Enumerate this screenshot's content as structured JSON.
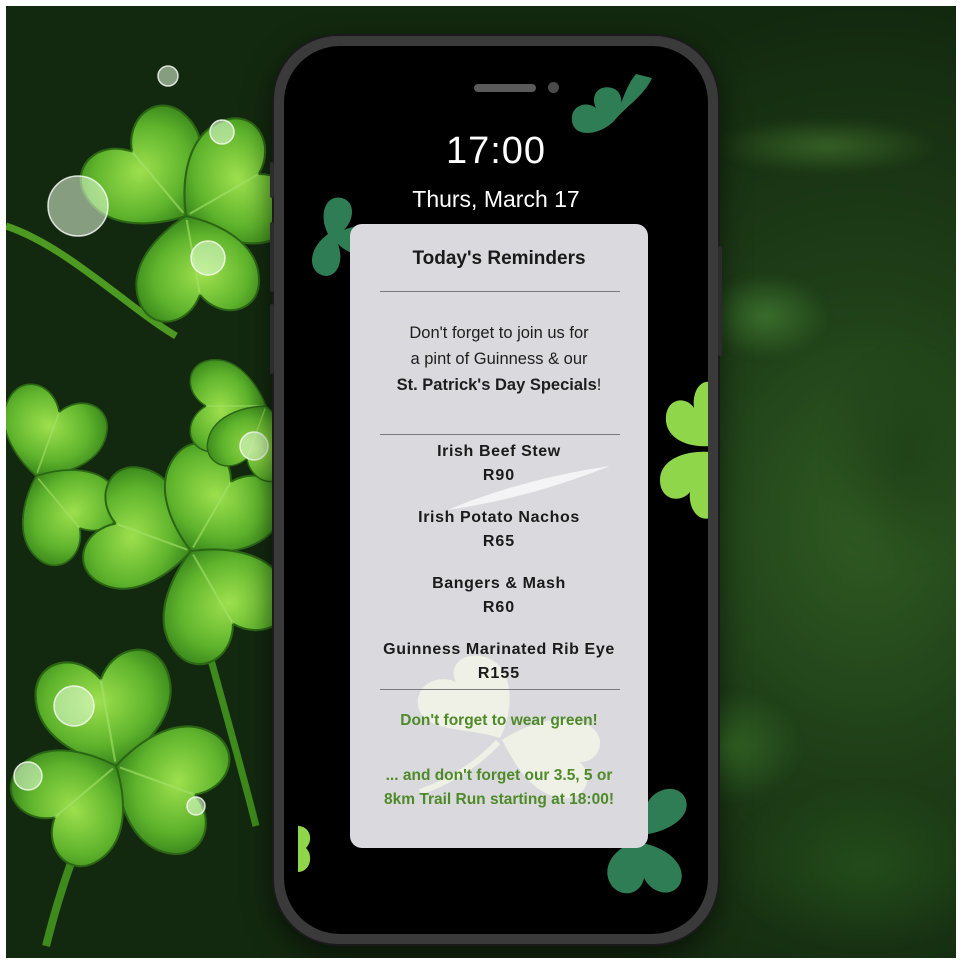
{
  "lockscreen": {
    "time": "17:00",
    "date": "Thurs, March 17"
  },
  "card": {
    "title": "Today's Reminders",
    "intro_line1": "Don't forget to join us for",
    "intro_line2": "a pint of Guinness & our",
    "intro_bold": "St. Patrick's Day Specials",
    "intro_end": "!",
    "menu": [
      {
        "name": "Irish Beef Stew",
        "price": "R90"
      },
      {
        "name": "Irish Potato Nachos",
        "price": "R65"
      },
      {
        "name": "Bangers & Mash",
        "price": "R60"
      },
      {
        "name": "Guinness Marinated Rib Eye",
        "price": "R155"
      }
    ],
    "green_note": "Don't forget to wear green!",
    "trail_note": "... and don't forget our 3.5, 5 or 8km Trail Run starting at 18:00!"
  },
  "colors": {
    "accent_green": "#4f8a28",
    "card_bg": "#d9d9de",
    "clover_dark": "#2e7d55",
    "clover_light": "#8fd64a"
  },
  "icons": [
    "shamrock-icon"
  ]
}
